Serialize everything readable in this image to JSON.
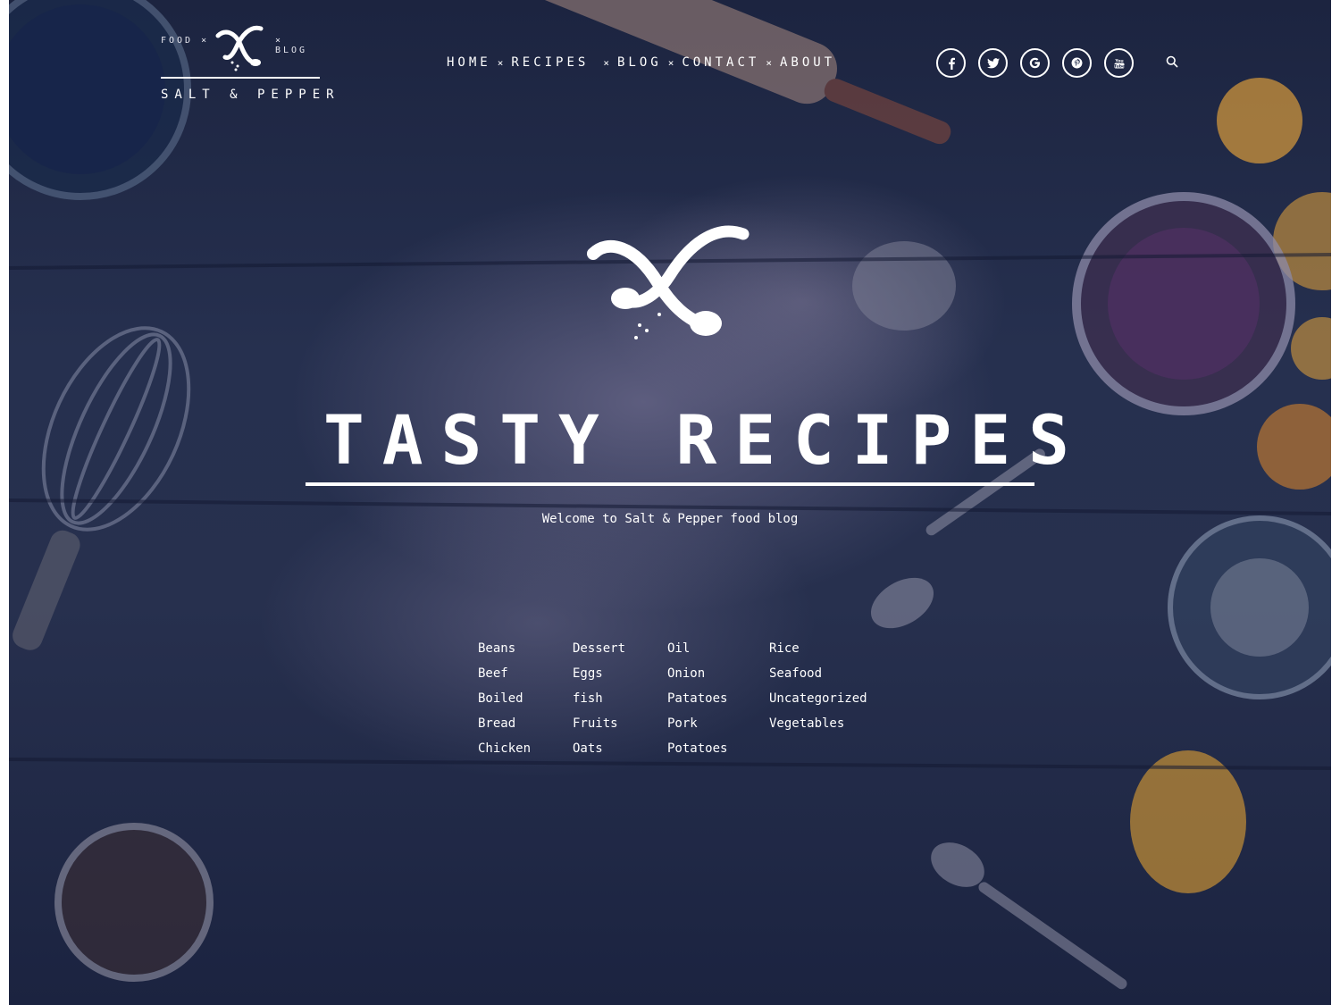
{
  "logo": {
    "left_text": "FOOD ×",
    "right_text": "× BLOG",
    "name": "SALT & PEPPER"
  },
  "nav": {
    "items": [
      "HOME",
      "RECIPES",
      "BLOG",
      "CONTACT",
      "ABOUT"
    ],
    "separator": "×"
  },
  "socials": [
    "facebook-icon",
    "twitter-icon",
    "google-icon",
    "pinterest-icon",
    "youtube-icon"
  ],
  "hero": {
    "title": "TASTY RECIPES",
    "subtitle": "Welcome to Salt & Pepper food blog"
  },
  "categories": {
    "col1": [
      "Beans",
      "Beef",
      "Boiled",
      "Bread",
      "Chicken"
    ],
    "col2": [
      "Dessert",
      "Eggs",
      "fish",
      "Fruits",
      "Oats"
    ],
    "col3": [
      "Oil",
      "Onion",
      "Patatoes",
      "Pork",
      "Potatoes"
    ],
    "col4": [
      "Rice",
      "Seafood",
      "Uncategorized",
      "Vegetables"
    ]
  },
  "colors": {
    "overlay": "#1f2846",
    "text": "#ffffff",
    "lemon": "#e8a53a"
  }
}
